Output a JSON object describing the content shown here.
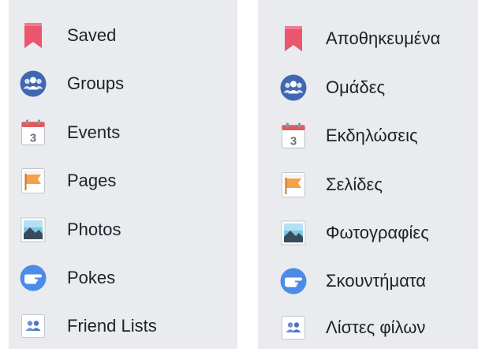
{
  "menus": {
    "english": {
      "items": [
        {
          "label": "Saved",
          "icon": "saved-bookmark-icon"
        },
        {
          "label": "Groups",
          "icon": "groups-icon"
        },
        {
          "label": "Events",
          "icon": "events-calendar-icon"
        },
        {
          "label": "Pages",
          "icon": "pages-flag-icon"
        },
        {
          "label": "Photos",
          "icon": "photos-icon"
        },
        {
          "label": "Pokes",
          "icon": "pokes-icon"
        },
        {
          "label": "Friend Lists",
          "icon": "friend-lists-icon"
        }
      ]
    },
    "greek": {
      "items": [
        {
          "label": "Αποθηκευμένα",
          "icon": "saved-bookmark-icon"
        },
        {
          "label": "Ομάδες",
          "icon": "groups-icon"
        },
        {
          "label": "Εκδηλώσεις",
          "icon": "events-calendar-icon"
        },
        {
          "label": "Σελίδες",
          "icon": "pages-flag-icon"
        },
        {
          "label": "Φωτογραφίες",
          "icon": "photos-icon"
        },
        {
          "label": "Σκουντήματα",
          "icon": "pokes-icon"
        },
        {
          "label": "Λίστες φίλων",
          "icon": "friend-lists-icon"
        }
      ]
    }
  },
  "calendar_icon": {
    "day": "3"
  },
  "colors": {
    "panel_background": "#e9ebee",
    "text": "#1d2129",
    "saved_red": "#e9566e",
    "groups_blue": "#4267b2",
    "calendar_red": "#e05a5a",
    "flag_orange": "#f5a04c",
    "pokes_blue": "#4c8be8"
  }
}
